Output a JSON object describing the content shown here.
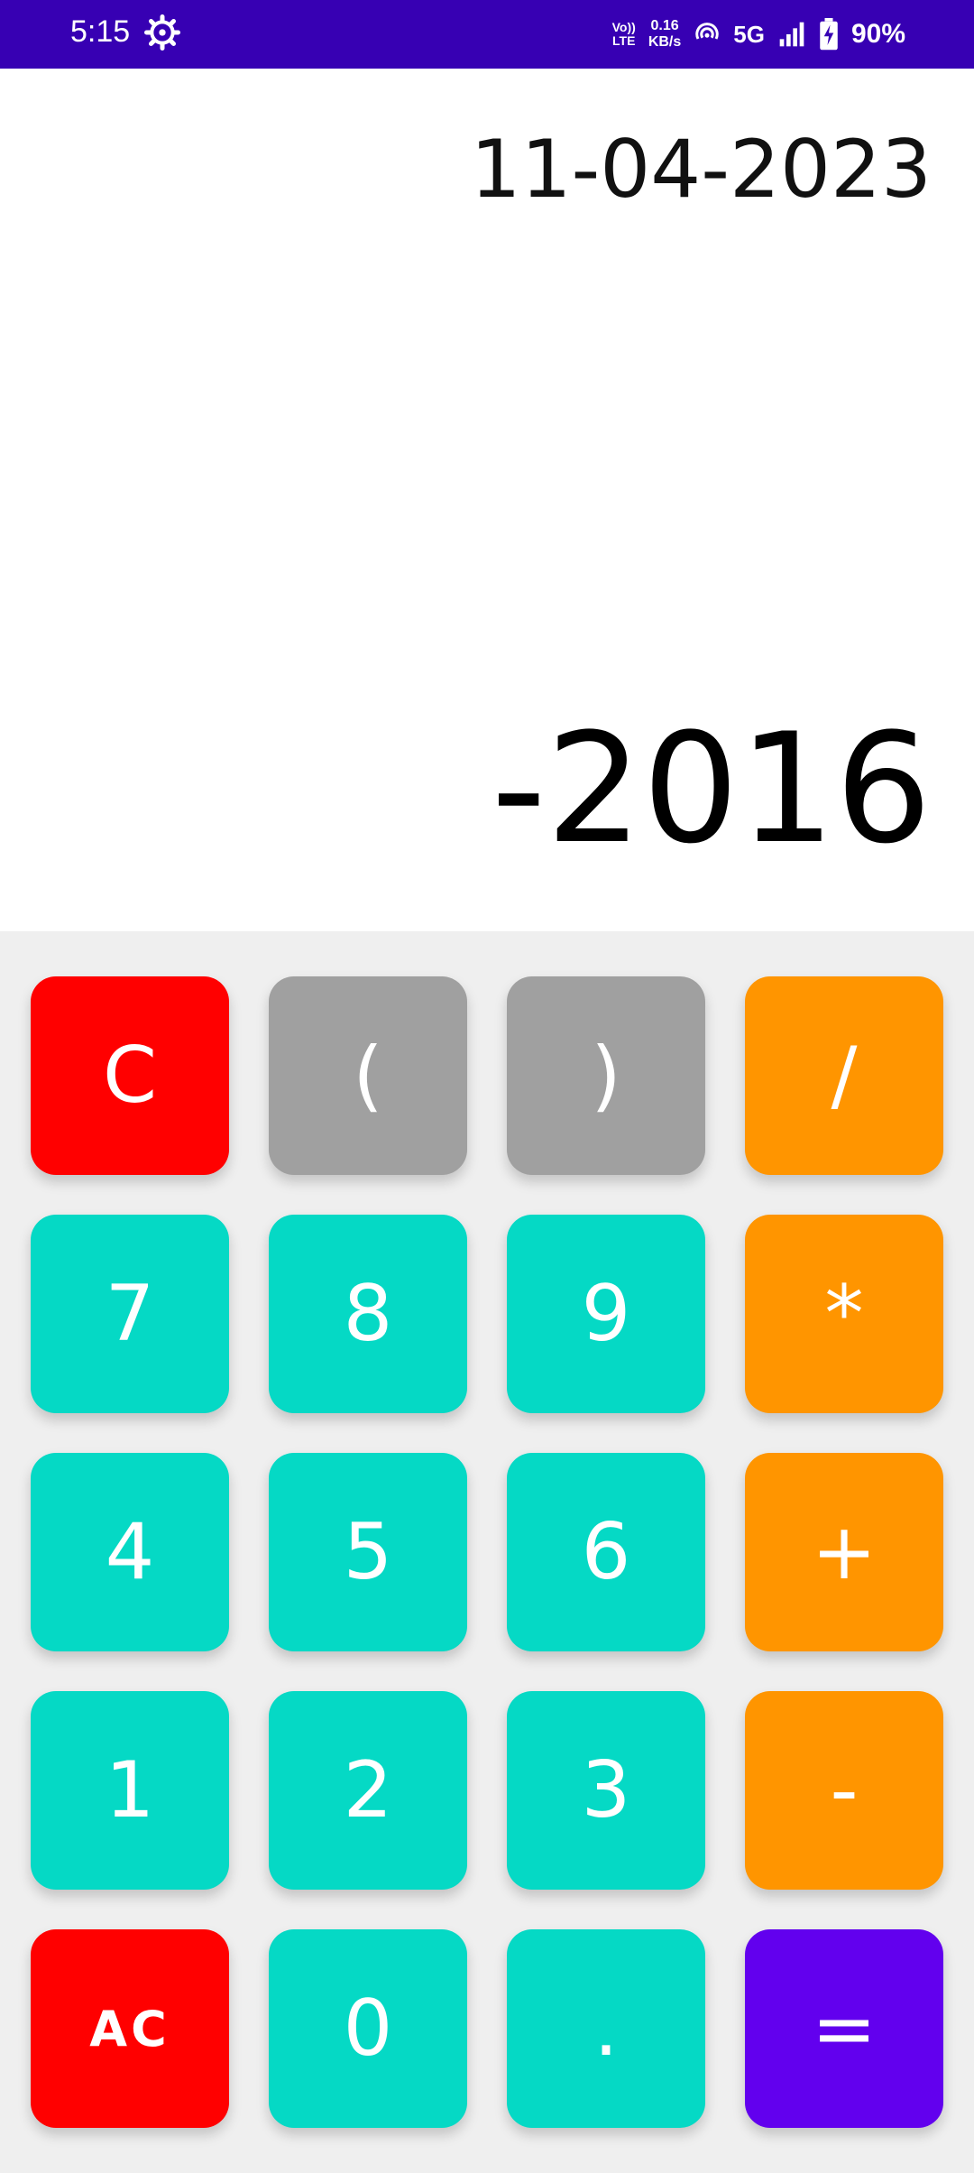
{
  "status_bar": {
    "time": "5:15",
    "icons": [
      "gear-icon",
      "volte-icon",
      "hotspot-icon",
      "signal-icon",
      "battery-charging-icon"
    ],
    "volte_line1": "Vo))",
    "volte_line2": "LTE",
    "speed_value": "0.16",
    "speed_unit": "KB/s",
    "network": "5G",
    "battery": "90%",
    "bg_color": "#3700b3"
  },
  "display": {
    "expression": "11-04-2023",
    "result": "-2016"
  },
  "keys": {
    "clear": "C",
    "open_paren": "(",
    "close_paren": ")",
    "divide": "/",
    "seven": "7",
    "eight": "8",
    "nine": "9",
    "multiply": "*",
    "four": "4",
    "five": "5",
    "six": "6",
    "plus": "+",
    "one": "1",
    "two": "2",
    "three": "3",
    "minus": "-",
    "all_clear": "AC",
    "zero": "0",
    "dot": ".",
    "equals": "="
  },
  "colors": {
    "clear": "#ff0000",
    "paren": "#a0a0a0",
    "operator": "#ff9500",
    "digit": "#05d9c5",
    "equals": "#6200ee",
    "keypad_bg": "#efefef"
  }
}
